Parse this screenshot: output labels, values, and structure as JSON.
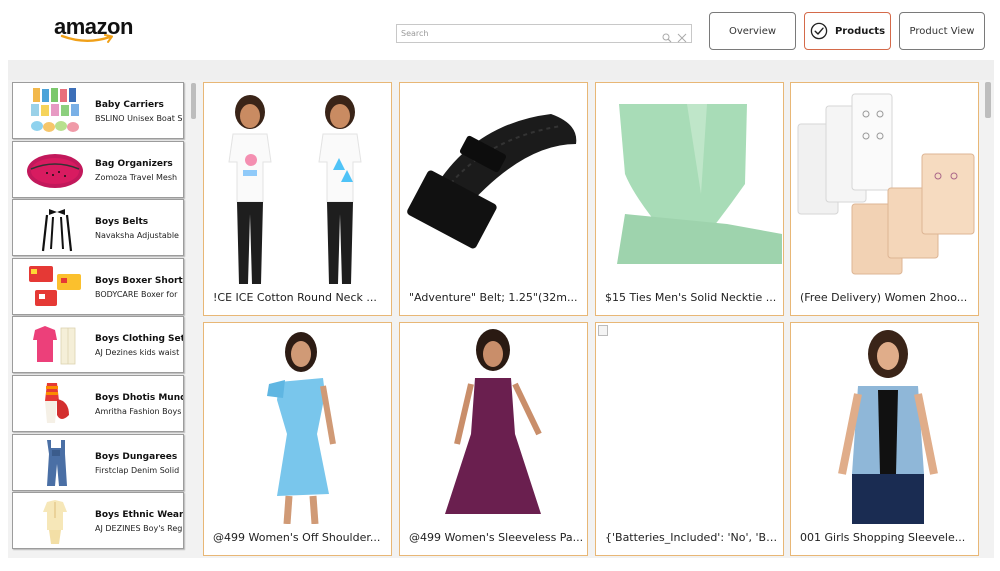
{
  "brand": {
    "logo_text": "amazon",
    "logo_smile_color": "#f0a018"
  },
  "search": {
    "placeholder": "Search",
    "value": ""
  },
  "nav": {
    "overview_label": "Overview",
    "products_label": "Products",
    "product_view_label": "Product View",
    "active": "Products",
    "active_color": "#d46a4a"
  },
  "sidebar": {
    "items": [
      {
        "title": "Baby Carriers",
        "subtitle": "BSLINO Unisex Boat S",
        "icon": "baby-socks-thumbnail"
      },
      {
        "title": "Bag Organizers",
        "subtitle": "Zomoza Travel Mesh",
        "icon": "pink-travel-case-thumbnail"
      },
      {
        "title": "Boys Belts",
        "subtitle": "Navaksha Adjustable",
        "icon": "suspenders-bowtie-thumbnail"
      },
      {
        "title": "Boys Boxer Shorts",
        "subtitle": "BODYCARE Boxer for",
        "icon": "boxer-shorts-thumbnail"
      },
      {
        "title": "Boys Clothing Sets",
        "subtitle": "AJ Dezines kids waist",
        "icon": "pink-shirt-set-thumbnail"
      },
      {
        "title": "Boys Dhotis Mund",
        "subtitle": "Amritha Fashion Boys",
        "icon": "dhoti-set-thumbnail"
      },
      {
        "title": "Boys Dungarees",
        "subtitle": "Firstclap Denim Solid",
        "icon": "denim-dungaree-thumbnail"
      },
      {
        "title": "Boys Ethnic Wear",
        "subtitle": "AJ DEZINES Boy's Reg",
        "icon": "ethnic-kurta-thumbnail"
      }
    ]
  },
  "products": [
    {
      "caption": "!CE ICE Cotton Round Neck ...",
      "image": "two-kids-tshirts"
    },
    {
      "caption": "\"Adventure\" Belt; 1.25\"(32m...",
      "image": "black-belt"
    },
    {
      "caption": "$15 Ties Men's Solid Necktie ...",
      "image": "mint-necktie"
    },
    {
      "caption": "(Free Delivery) Women 2hoo...",
      "image": "bra-extenders"
    },
    {
      "caption": "@499 Women's Off Shoulder...",
      "image": "blue-dress-woman"
    },
    {
      "caption": "@499 Women's Sleeveless Pa...",
      "image": "purple-dress-woman"
    },
    {
      "caption": "{'Batteries_Included': 'No', 'Br...",
      "image": "broken-image"
    },
    {
      "caption": "001 Girls Shopping Sleevele...",
      "image": "denim-vest-woman"
    }
  ],
  "colors": {
    "card_border": "#e8b776",
    "panel_bg": "#f2f2f2"
  }
}
